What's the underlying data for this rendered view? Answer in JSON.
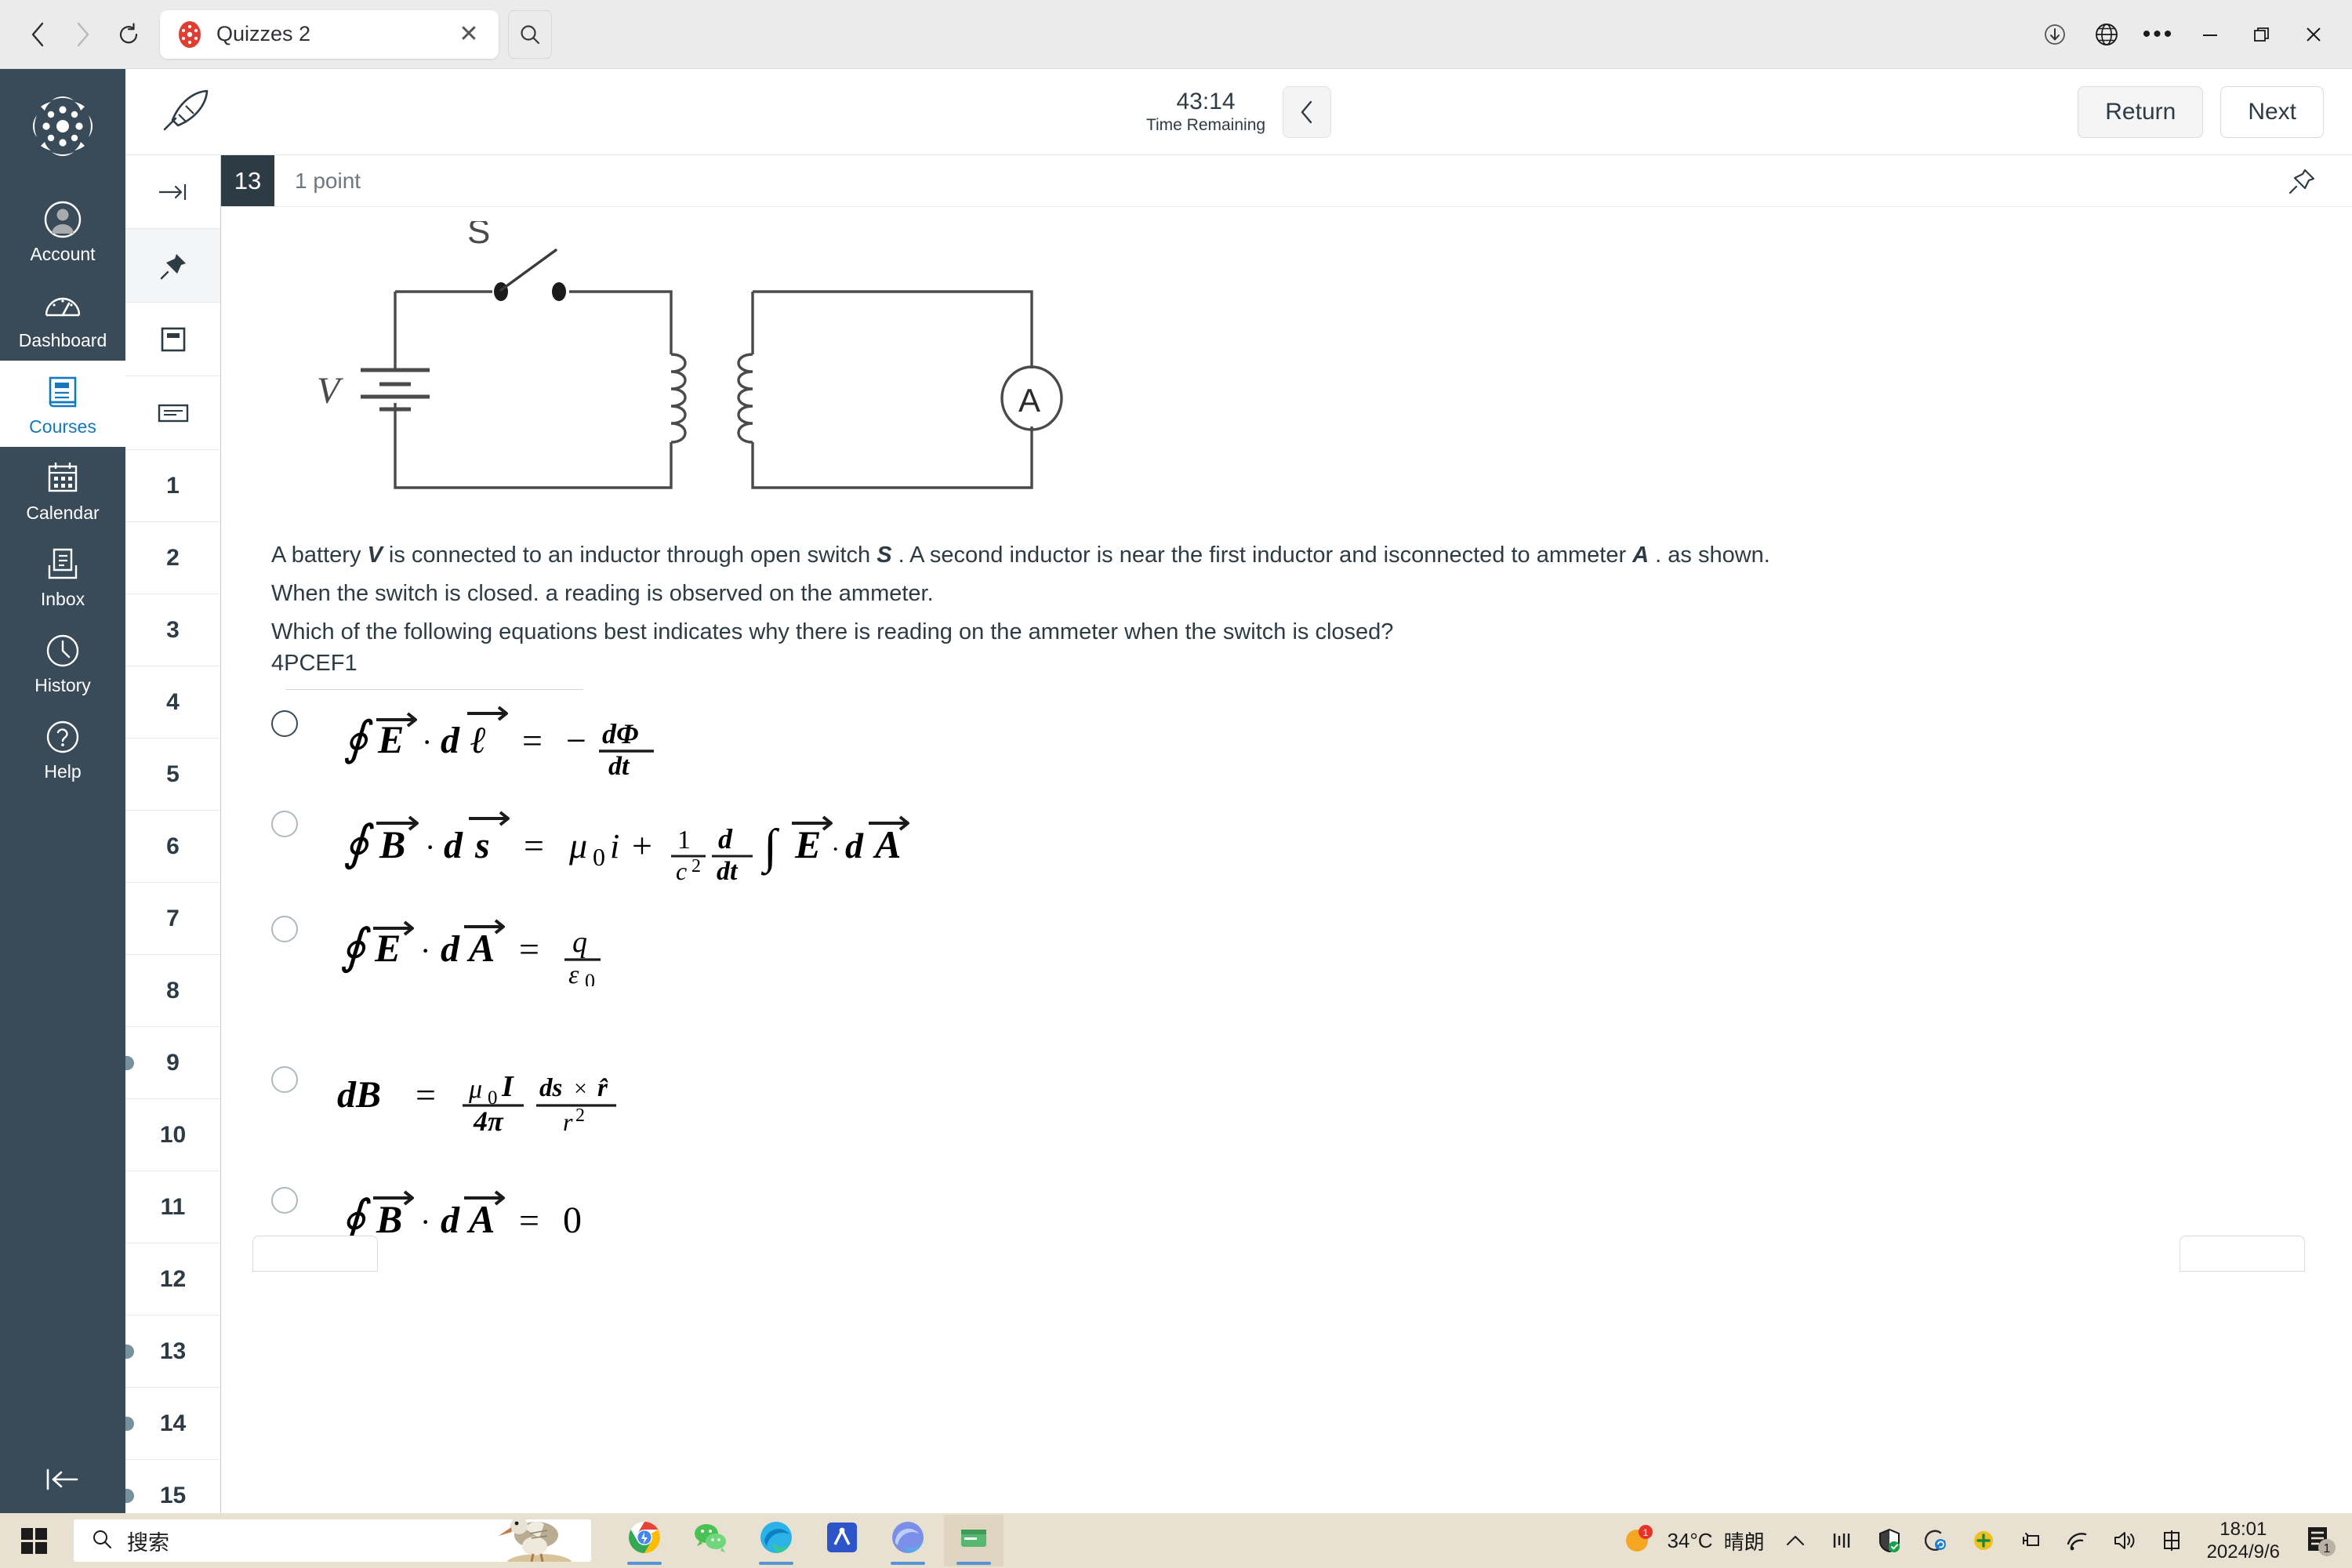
{
  "browser": {
    "nav": {
      "back": "‹",
      "forward": "›",
      "reload": "⟳"
    },
    "tab": {
      "title": "Quizzes 2",
      "close": "✕"
    },
    "window_controls": {
      "minimize": "—",
      "maximize": "❐",
      "close": "✕",
      "more": "•••"
    }
  },
  "global_nav": {
    "items": [
      {
        "label": "Account",
        "icon": "account-icon"
      },
      {
        "label": "Dashboard",
        "icon": "dashboard-icon"
      },
      {
        "label": "Courses",
        "icon": "courses-icon"
      },
      {
        "label": "Calendar",
        "icon": "calendar-icon"
      },
      {
        "label": "Inbox",
        "icon": "inbox-icon"
      },
      {
        "label": "History",
        "icon": "history-icon"
      },
      {
        "label": "Help",
        "icon": "help-icon"
      }
    ],
    "active": "Courses",
    "collapse_label": "|←"
  },
  "quiz_header": {
    "time_remaining": "43:14",
    "time_label": "Time Remaining",
    "collapse_icon": "chevron-left-icon",
    "return_label": "Return",
    "next_label": "Next"
  },
  "question_rail": {
    "tools": [
      "go-to-icon",
      "pin-icon",
      "notepad-icon",
      "transcript-icon"
    ],
    "numbers": [
      {
        "n": "1",
        "marked": false
      },
      {
        "n": "2",
        "marked": false
      },
      {
        "n": "3",
        "marked": false
      },
      {
        "n": "4",
        "marked": false
      },
      {
        "n": "5",
        "marked": false
      },
      {
        "n": "6",
        "marked": false
      },
      {
        "n": "7",
        "marked": false
      },
      {
        "n": "8",
        "marked": false
      },
      {
        "n": "9",
        "marked": true
      },
      {
        "n": "10",
        "marked": false
      },
      {
        "n": "11",
        "marked": false
      },
      {
        "n": "12",
        "marked": false
      },
      {
        "n": "13",
        "marked": true
      },
      {
        "n": "14",
        "marked": true
      },
      {
        "n": "15",
        "marked": true
      }
    ]
  },
  "question": {
    "number": "13",
    "points": "1 point",
    "pin_icon": "pin-icon",
    "diagram": {
      "battery_label": "V",
      "switch_label": "S",
      "ammeter_label": "A"
    },
    "text_line1_a": "A battery ",
    "text_line1_v": "V",
    "text_line1_b": " is connected to an inductor through open switch ",
    "text_line1_s": "S",
    "text_line1_c": " . A second inductor is near the first inductor and isconnected to ammeter ",
    "text_line1_ammeter": "A",
    "text_line1_d": " . as shown.",
    "text_line2": "When the switch is closed. a reading is observed on the ammeter.",
    "text_line3": "Which of the following equations best indicates why there is reading on the ammeter when the switch is closed?",
    "code": "4PCEF1",
    "options": [
      {
        "id": "a",
        "latex": "∮ E⃗ · d ℓ⃗ = − dΦ/dt",
        "selected": false,
        "emphasis": "dark"
      },
      {
        "id": "b",
        "latex": "∮ B⃗ · d s⃗ = μ₀i + (1/c²) (d/dt) ∫ E⃗·d A⃗",
        "selected": false,
        "emphasis": "light"
      },
      {
        "id": "c",
        "latex": "∮ E⃗ · d A⃗ = q/ε₀",
        "selected": false,
        "emphasis": "light"
      },
      {
        "id": "d",
        "latex": "dB = (μ₀I / 4π) (ds×r̂ / r²)",
        "selected": false,
        "emphasis": "light"
      },
      {
        "id": "e",
        "latex": "∮ B⃗ · d A⃗ = 0",
        "selected": false,
        "emphasis": "light"
      }
    ]
  },
  "taskbar": {
    "search_placeholder": "搜索",
    "weather_temp": "34°C",
    "weather_desc": "晴朗",
    "clock_time": "18:01",
    "clock_date": "2024/9/6",
    "notification_count": "1",
    "tray_icons": [
      "chevron-up-icon",
      "network-monitor-icon",
      "defender-shield-icon",
      "sync-icon",
      "plus-circle-icon",
      "usb-icon",
      "wifi-icon",
      "speaker-icon",
      "ime-icon"
    ],
    "apps": [
      "chrome-icon",
      "wechat-icon",
      "edge-icon",
      "xmind-icon",
      "browser-icon",
      "window-icon"
    ]
  }
}
